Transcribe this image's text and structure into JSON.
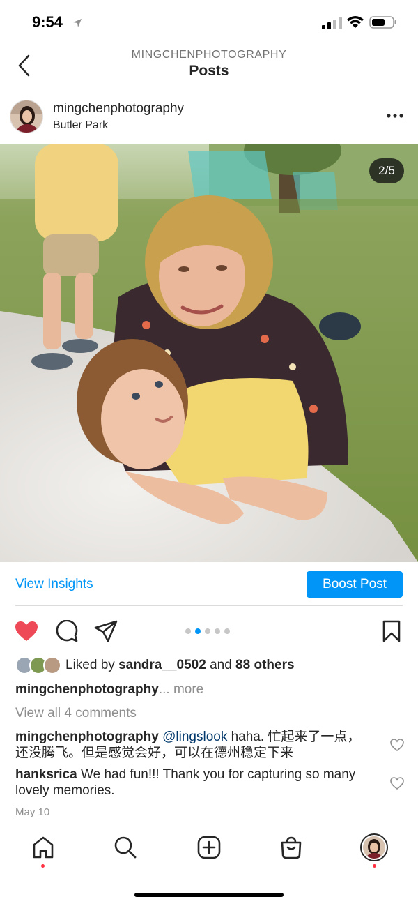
{
  "status_bar": {
    "time": "9:54"
  },
  "nav": {
    "subtitle": "MINGCHENPHOTOGRAPHY",
    "title": "Posts"
  },
  "post": {
    "username": "mingchenphotography",
    "location": "Butler Park",
    "image_counter": "2/5",
    "carousel": {
      "total": 5,
      "current": 2
    },
    "liked": true
  },
  "insights": {
    "view_insights": "View Insights",
    "boost_post": "Boost Post"
  },
  "likes": {
    "prefix": "Liked by",
    "user": "sandra__0502",
    "middle": "and",
    "others": "88 others"
  },
  "caption": {
    "username": "mingchenphotography",
    "ellipsis": "...",
    "more": "more"
  },
  "view_all_comments": "View all 4 comments",
  "comments": [
    {
      "username": "mingchenphotography",
      "mention": "@lingslook",
      "text": "haha. 忙起来了一点，还没腾飞。但是感觉会好，可以在德州稳定下来"
    },
    {
      "username": "hanksrica",
      "mention": "",
      "text": "We had fun!!! Thank you for capturing so many lovely memories."
    }
  ],
  "post_date": "May 10",
  "tabbar": {
    "items": [
      {
        "icon": "home-icon",
        "dot": true
      },
      {
        "icon": "search-icon",
        "dot": false
      },
      {
        "icon": "add-post-icon",
        "dot": false
      },
      {
        "icon": "shop-bag-icon",
        "dot": false
      },
      {
        "icon": "profile-avatar",
        "dot": true
      }
    ]
  },
  "colors": {
    "accent": "#0095f6",
    "like_red": "#ed4956",
    "notify_red": "#ff3040",
    "text": "#262626",
    "muted": "#8e8e8e"
  }
}
